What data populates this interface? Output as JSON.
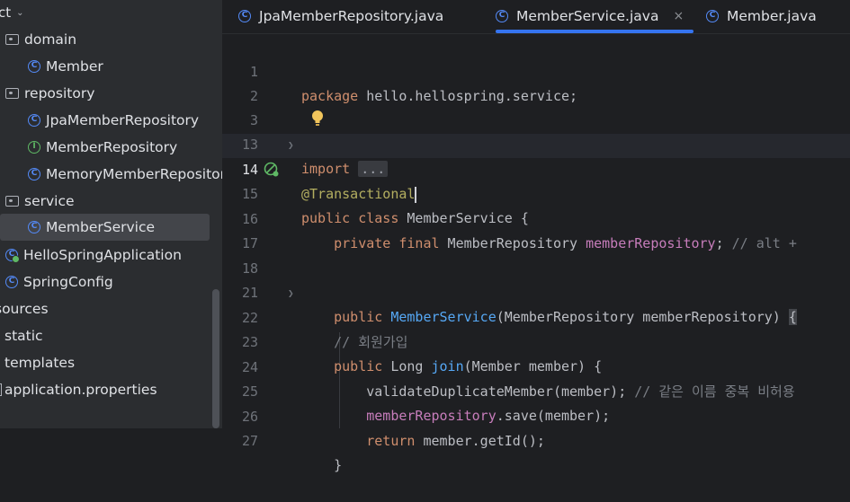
{
  "sidebar": {
    "header": "ct",
    "items": [
      {
        "label": "domain",
        "icon": "package-icon"
      },
      {
        "label": "Member",
        "icon": "class-icon"
      },
      {
        "label": "repository",
        "icon": "package-icon"
      },
      {
        "label": "JpaMemberRepository",
        "icon": "class-icon"
      },
      {
        "label": "MemberRepository",
        "icon": "interface-icon"
      },
      {
        "label": "MemoryMemberRepositor",
        "icon": "class-icon"
      },
      {
        "label": "service",
        "icon": "package-icon"
      },
      {
        "label": "MemberService",
        "icon": "class-icon"
      },
      {
        "label": "HelloSpringApplication",
        "icon": "spring-class-icon"
      },
      {
        "label": "SpringConfig",
        "icon": "class-icon"
      },
      {
        "label": "sources",
        "icon": ""
      },
      {
        "label": "static",
        "icon": ""
      },
      {
        "label": "templates",
        "icon": ""
      },
      {
        "label": "application.properties",
        "icon": ""
      }
    ],
    "selected": "MemberService"
  },
  "tabs": [
    {
      "label": "JpaMemberRepository.java"
    },
    {
      "label": "MemberService.java",
      "active": true,
      "close": "×"
    },
    {
      "label": "Member.java"
    }
  ],
  "editor": {
    "current_line": "14",
    "lines": [
      {
        "num": "1",
        "t1": "package",
        "t2": " hello.hellospring.service;"
      },
      {
        "num": "2"
      },
      {
        "num": "3",
        "t1": "import",
        "t2": " ",
        "folded": "..."
      },
      {
        "num": "13"
      },
      {
        "num": "14",
        "ann": "@Transactional"
      },
      {
        "num": "15",
        "t1": "public class",
        "t2": " MemberService {"
      },
      {
        "num": "16",
        "indent": "    ",
        "t1": "private final",
        "t2": " MemberRepository ",
        "field": "memberRepository",
        "t3": "; ",
        "comment": "// alt +"
      },
      {
        "num": "17"
      },
      {
        "num": "18",
        "indent": "    ",
        "t1": "public",
        "t2": " ",
        "method": "MemberService",
        "t3": "(MemberRepository memberRepository) ",
        "brace": "{"
      },
      {
        "num": "21"
      },
      {
        "num": "22",
        "indent": "    ",
        "comment": "// 회원가입"
      },
      {
        "num": "23",
        "indent": "    ",
        "t1": "public",
        "t2": " Long ",
        "method": "join",
        "t3": "(Member member) {"
      },
      {
        "num": "24",
        "indent": "        ",
        "t2": "validateDuplicateMember(member); ",
        "comment": "// 같은 이름 중복 비허용"
      },
      {
        "num": "25",
        "indent": "        ",
        "field": "memberRepository",
        "t3": ".save(member);"
      },
      {
        "num": "26",
        "indent": "        ",
        "t1": "return",
        "t2": " member.getId();"
      },
      {
        "num": "27",
        "indent": "    ",
        "t2": "}"
      }
    ]
  },
  "colors": {
    "keyword": "#cf8e6d",
    "annotation": "#b3ae60",
    "field": "#c77dbb",
    "method": "#56a8f5",
    "comment": "#7a7e85",
    "accent": "#3574f0"
  }
}
